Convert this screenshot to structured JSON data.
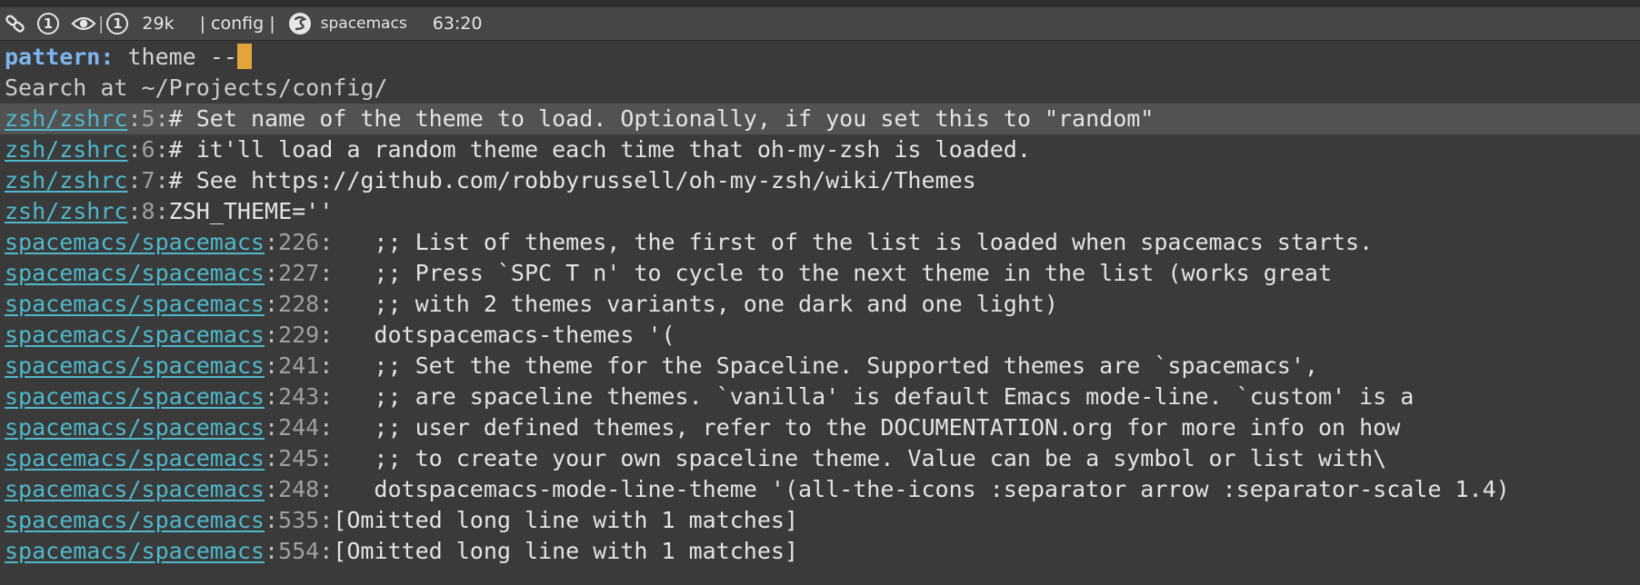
{
  "modeline": {
    "window_number": "1",
    "buffer_indicator": "1",
    "buffer_size": "29k",
    "project": "| config |",
    "mode_name": "spacemacs",
    "position": "63:20",
    "icons": [
      "link-icon",
      "circle-number-icon",
      "eye-icon",
      "circle-number-icon",
      "spacemacs-logo-icon"
    ]
  },
  "minibuffer": {
    "label": "pattern:",
    "input": " theme --"
  },
  "search_header": "Search at ~/Projects/config/",
  "results": [
    {
      "file": "zsh/zshrc",
      "line": "5",
      "text": "# Set name of the theme to load. Optionally, if you set this to \"random\"",
      "selected": true
    },
    {
      "file": "zsh/zshrc",
      "line": "6",
      "text": "# it'll load a random theme each time that oh-my-zsh is loaded.",
      "selected": false
    },
    {
      "file": "zsh/zshrc",
      "line": "7",
      "text": "# See https://github.com/robbyrussell/oh-my-zsh/wiki/Themes",
      "selected": false
    },
    {
      "file": "zsh/zshrc",
      "line": "8",
      "text": "ZSH_THEME=''",
      "selected": false
    },
    {
      "file": "spacemacs/spacemacs",
      "line": "226",
      "text": "   ;; List of themes, the first of the list is loaded when spacemacs starts.",
      "selected": false
    },
    {
      "file": "spacemacs/spacemacs",
      "line": "227",
      "text": "   ;; Press `SPC T n' to cycle to the next theme in the list (works great",
      "selected": false
    },
    {
      "file": "spacemacs/spacemacs",
      "line": "228",
      "text": "   ;; with 2 themes variants, one dark and one light)",
      "selected": false
    },
    {
      "file": "spacemacs/spacemacs",
      "line": "229",
      "text": "   dotspacemacs-themes '(",
      "selected": false
    },
    {
      "file": "spacemacs/spacemacs",
      "line": "241",
      "text": "   ;; Set the theme for the Spaceline. Supported themes are `spacemacs',",
      "selected": false
    },
    {
      "file": "spacemacs/spacemacs",
      "line": "243",
      "text": "   ;; are spaceline themes. `vanilla' is default Emacs mode-line. `custom' is a",
      "selected": false
    },
    {
      "file": "spacemacs/spacemacs",
      "line": "244",
      "text": "   ;; user defined themes, refer to the DOCUMENTATION.org for more info on how",
      "selected": false
    },
    {
      "file": "spacemacs/spacemacs",
      "line": "245",
      "text": "   ;; to create your own spaceline theme. Value can be a symbol or list with\\",
      "selected": false
    },
    {
      "file": "spacemacs/spacemacs",
      "line": "248",
      "text": "   dotspacemacs-mode-line-theme '(all-the-icons :separator arrow :separator-scale 1.4)",
      "selected": false
    },
    {
      "file": "spacemacs/spacemacs",
      "line": "535",
      "text": "[Omitted long line with 1 matches]",
      "selected": false
    },
    {
      "file": "spacemacs/spacemacs",
      "line": "554",
      "text": "[Omitted long line with 1 matches]",
      "selected": false
    }
  ],
  "colors": {
    "background": "#3a3a3a",
    "modeline": "#464646",
    "selected_row": "#525252",
    "file_link": "#4fb8cc",
    "prompt_label": "#7eb6f0",
    "cursor": "#e3a53a"
  }
}
